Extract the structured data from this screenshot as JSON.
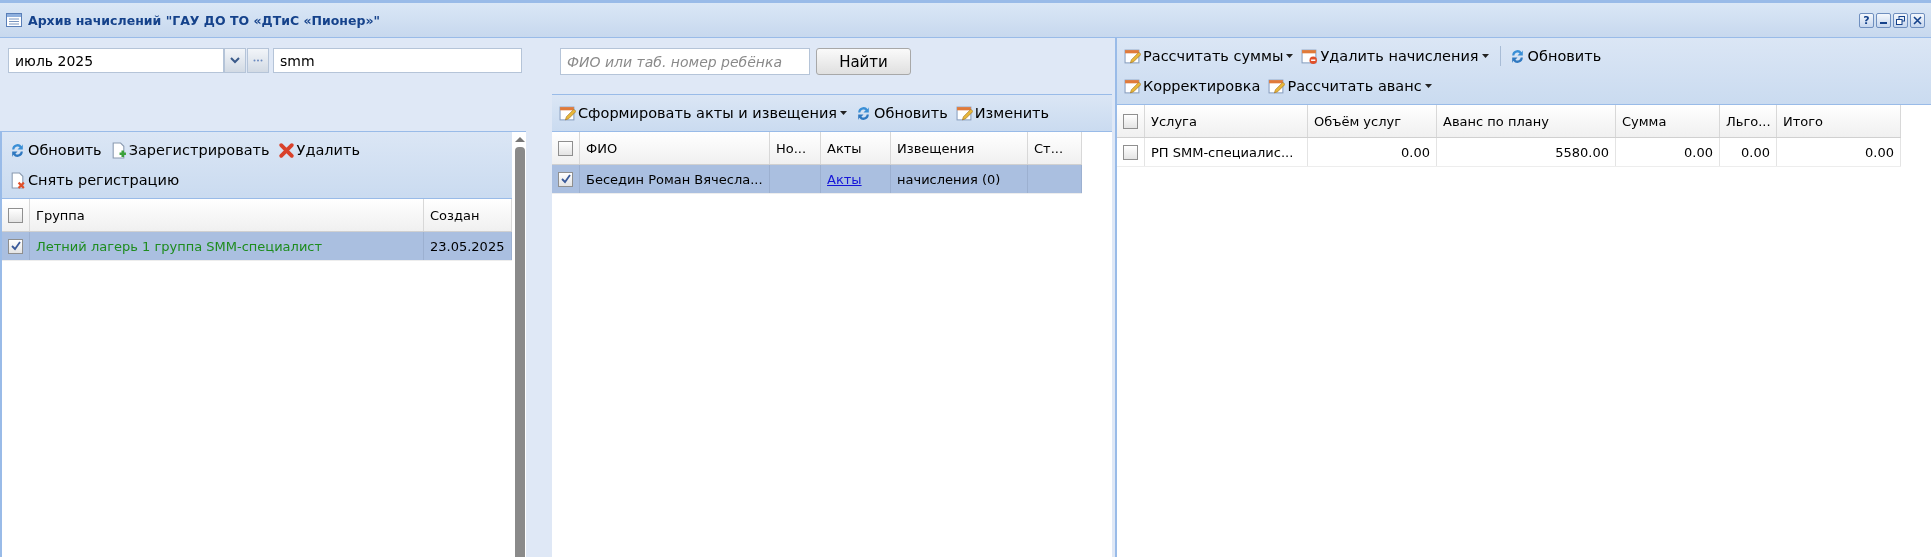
{
  "window": {
    "title": "Архив начислений \"ГАУ ДО ТО «ДТиС «Пионер»\"",
    "help_button": "?"
  },
  "left": {
    "period_field": {
      "value": "июль 2025"
    },
    "filter_field": {
      "value": "smm"
    },
    "toolbar": [
      [
        {
          "label": "Обновить",
          "kind": "refresh",
          "menu": false
        },
        {
          "label": "Зарегистрировать",
          "kind": "register",
          "menu": false
        },
        {
          "label": "Удалить",
          "kind": "delete",
          "menu": false
        }
      ],
      [
        {
          "label": "Снять регистрацию",
          "kind": "unregister",
          "menu": false
        }
      ]
    ],
    "grid": {
      "header_checked": false,
      "columns": [
        {
          "label": "Группа"
        },
        {
          "label": "Создан"
        }
      ],
      "rows": [
        {
          "checked": true,
          "selected": true,
          "cells": [
            "Летний лагерь 1 группа SMM-специалист",
            "23.05.2025"
          ]
        }
      ]
    }
  },
  "middle": {
    "search_field": {
      "placeholder": "ФИО или таб. номер ребёнка"
    },
    "find_button": "Найти",
    "toolbar": [
      [
        {
          "label": "Сформировать акты и извещения",
          "kind": "edit",
          "menu": true
        },
        {
          "label": "Обновить",
          "kind": "refresh",
          "menu": false
        },
        {
          "label": "Изменить",
          "kind": "edit",
          "menu": false
        }
      ]
    ],
    "grid": {
      "header_checked": false,
      "columns": [
        {
          "label": "ФИО"
        },
        {
          "label": "Но..."
        },
        {
          "label": "Акты",
          "kind": "link"
        },
        {
          "label": "Извещения"
        },
        {
          "label": "Ст..."
        }
      ],
      "rows": [
        {
          "checked": true,
          "selected": true,
          "cells": [
            "Беседин Роман Вячесла...",
            "",
            "Акты",
            "начисления (0)",
            ""
          ]
        }
      ]
    }
  },
  "right": {
    "toolbar": [
      [
        {
          "label": "Рассчитать суммы",
          "kind": "edit",
          "menu": true
        },
        {
          "label": "Удалить начисления",
          "kind": "remove",
          "menu": true
        },
        {
          "label": "Обновить",
          "kind": "refresh",
          "menu": false,
          "separator_before": true
        }
      ],
      [
        {
          "label": "Корректировка",
          "kind": "edit",
          "menu": false
        },
        {
          "label": "Рассчитать аванс",
          "kind": "edit",
          "menu": true
        }
      ]
    ],
    "grid": {
      "header_checked": false,
      "columns": [
        {
          "label": "Услуга"
        },
        {
          "label": "Объём услуг",
          "kind": "number"
        },
        {
          "label": "Аванс по плану",
          "kind": "number"
        },
        {
          "label": "Сумма",
          "kind": "number"
        },
        {
          "label": "Льго...",
          "kind": "number"
        },
        {
          "label": "Итого",
          "kind": "number"
        }
      ],
      "rows": [
        {
          "checked": false,
          "selected": false,
          "cells": [
            "РП SMM-специалис...",
            "0.00",
            "5580.00",
            "0.00",
            "0.00",
            "0.00"
          ]
        }
      ]
    }
  }
}
